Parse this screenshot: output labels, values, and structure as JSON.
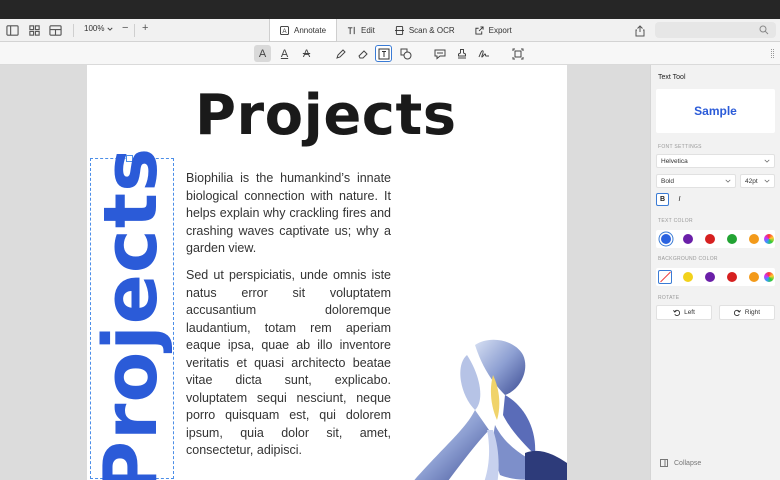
{
  "toolbar": {
    "zoom": "100%",
    "zoom_minus": "−",
    "zoom_plus": "+",
    "tabs": [
      {
        "label": "Annotate",
        "icon": "annotate-icon"
      },
      {
        "label": "Edit",
        "icon": "edit-text-icon"
      },
      {
        "label": "Scan & OCR",
        "icon": "scan-icon"
      },
      {
        "label": "Export",
        "icon": "export-icon"
      }
    ],
    "text_tools": [
      "A",
      "A",
      "A"
    ]
  },
  "document": {
    "title": "Projects",
    "paragraph1": "Biophilia is the humankind’s innate biological connection with nature. It helps explain why crackling fires and crashing waves captivate us; why a garden view.",
    "paragraph2": "Sed ut perspiciatis, unde omnis iste natus error sit voluptatem accusantium doloremque laudantium, totam rem aperiam eaque ipsa, quae ab illo inventore veritatis et quasi architecto beatae vitae dicta sunt, explicabo. voluptatem sequi nesciunt, neque porro quisquam est, qui dolorem ipsum, quia dolor sit, amet, consectetur, adipisci.",
    "vertical_text": "Projects"
  },
  "side": {
    "title": "Text Tool",
    "sample": "Sample",
    "font_settings_label": "FONT SETTINGS",
    "font": "Helvetica",
    "weight": "Bold",
    "size": "42pt",
    "bold_label": "B",
    "italic_label": "I",
    "text_color_label": "TEXT COLOR",
    "background_color_label": "BACKGROUND COLOR",
    "rotate_label": "ROTATE",
    "rotate_left": "Left",
    "rotate_right": "Right",
    "collapse": "Collapse",
    "text_colors": [
      "#2b63e0",
      "#6a1fa8",
      "#d62020",
      "#22a333",
      "#f39a1a"
    ],
    "background_colors": [
      "#f2d21b",
      "#6a1fa8",
      "#d62020",
      "#f39a1a"
    ]
  },
  "colors": {
    "accent": "#3a7bd5",
    "vertical_text": "#2b5bd8"
  }
}
